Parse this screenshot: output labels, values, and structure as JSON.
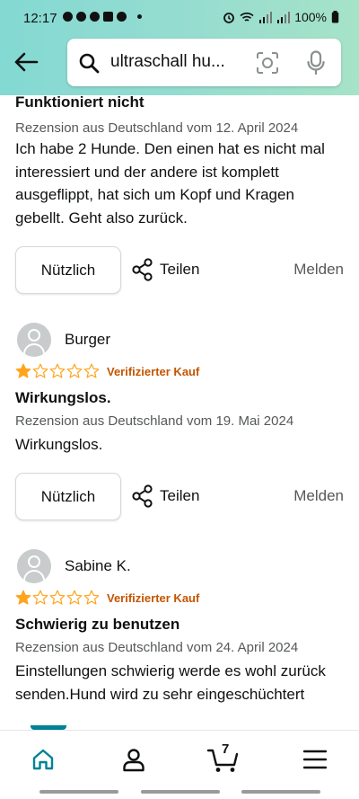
{
  "status_bar": {
    "time": "12:17",
    "battery": "100%"
  },
  "search": {
    "query": "ultraschall hu..."
  },
  "reviews": [
    {
      "title": "Funktioniert nicht",
      "meta": "Rezension aus Deutschland vom 12. April 2024",
      "body": "Ich habe 2 Hunde. Den einen hat es nicht mal interessiert und der andere ist komplett ausgeflippt, hat sich um Kopf und Kragen gebellt. Geht also zurück."
    },
    {
      "reviewer": "Burger",
      "rating": 1,
      "max_rating": 5,
      "verified_label": "Verifizierter Kauf",
      "title": "Wirkungslos.",
      "meta": "Rezension aus Deutschland vom 19. Mai 2024",
      "body": "Wirkungslos."
    },
    {
      "reviewer": "Sabine K.",
      "rating": 1,
      "max_rating": 5,
      "verified_label": "Verifizierter Kauf",
      "title": "Schwierig zu benutzen",
      "meta": "Rezension aus Deutschland vom 24. April 2024",
      "body": "Einstellungen schwierig werde es wohl zurück senden.Hund wird zu sehr eingeschüchtert"
    }
  ],
  "actions": {
    "helpful_label": "Nützlich",
    "share_label": "Teilen",
    "report_label": "Melden"
  },
  "bottom_nav": {
    "cart_count": "7"
  },
  "colors": {
    "header_gradient": [
      "#83d9d3",
      "#a6e3c8"
    ],
    "star": "#ffa41c",
    "verified": "#c45500",
    "nav_active": "#008296"
  }
}
